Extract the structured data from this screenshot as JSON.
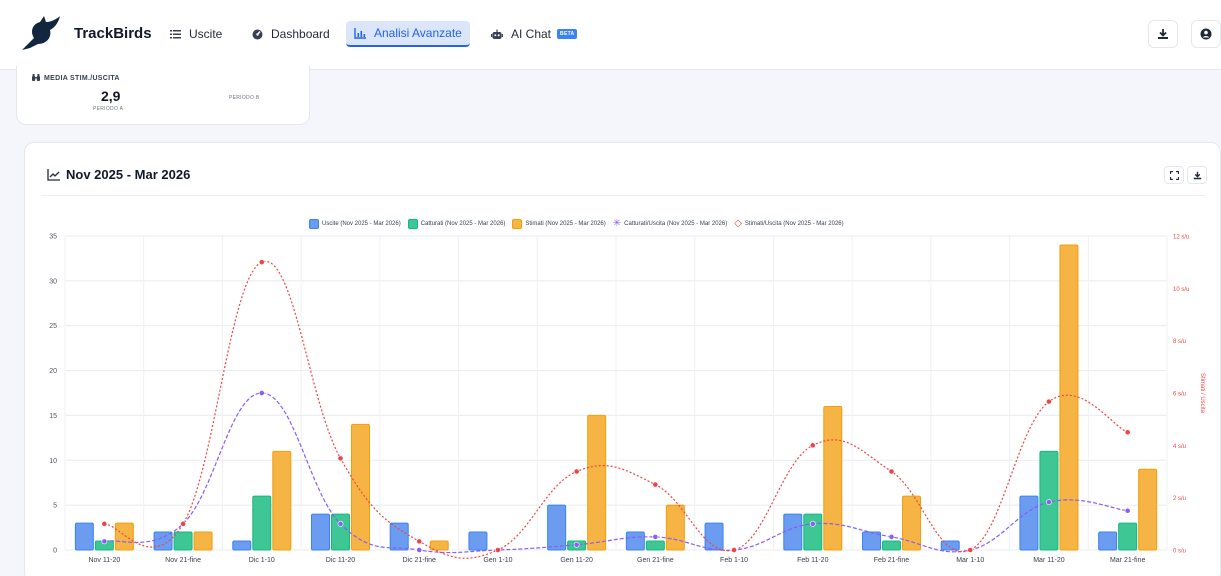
{
  "nav": {
    "brand": "TrackBirds",
    "items": [
      {
        "label": "Uscite",
        "icon": "list-icon"
      },
      {
        "label": "Dashboard",
        "icon": "dashboard-icon"
      },
      {
        "label": "Analisi Avanzate",
        "icon": "chart-icon",
        "active": true
      },
      {
        "label": "AI Chat",
        "icon": "robot-icon",
        "badge": "BETA"
      }
    ],
    "right_buttons": [
      "download-icon",
      "user-icon"
    ]
  },
  "stat": {
    "title": "MEDIA STIM./USCITA",
    "value": "2,9",
    "period_a": "PERIODO A",
    "period_b": "PERIODO B"
  },
  "chart_card": {
    "title": "Nov 2025 - Mar 2026",
    "buttons": [
      "fullscreen-icon",
      "download-icon"
    ]
  },
  "colors": {
    "uscite": "#6b9cf0",
    "catturati": "#3ec795",
    "stimati": "#f5b444",
    "catt_line": "#8b5cf6",
    "stim_line": "#ef4444",
    "accent": "#2563eb"
  },
  "chart_data": {
    "type": "bar",
    "categories": [
      "Nov 11-20",
      "Nov 21-fine",
      "Dic 1-10",
      "Dic 11-20",
      "Dic 21-fine",
      "Gen 1-10",
      "Gen 11-20",
      "Gen 21-fine",
      "Feb 1-10",
      "Feb 11-20",
      "Feb 21-fine",
      "Mar 1-10",
      "Mar 11-20",
      "Mar 21-fine"
    ],
    "series": [
      {
        "name": "Uscite (Nov 2025 - Mar 2026)",
        "kind": "bar",
        "axis": "left",
        "values": [
          3,
          2,
          1,
          4,
          3,
          2,
          5,
          2,
          3,
          4,
          2,
          1,
          6,
          2
        ]
      },
      {
        "name": "Catturati (Nov 2025 - Mar 2026)",
        "kind": "bar",
        "axis": "left",
        "values": [
          1,
          2,
          6,
          4,
          0,
          0,
          1,
          1,
          0,
          4,
          1,
          0,
          11,
          3
        ]
      },
      {
        "name": "Stimati (Nov 2025 - Mar 2026)",
        "kind": "bar",
        "axis": "left",
        "values": [
          3,
          2,
          11,
          14,
          1,
          0,
          15,
          5,
          0,
          16,
          6,
          0,
          34,
          9
        ]
      },
      {
        "name": "Catturati/Uscita (Nov 2025 - Mar 2026)",
        "kind": "line",
        "axis": "right",
        "values": [
          0.33,
          1.0,
          6.0,
          1.0,
          0,
          0,
          0.2,
          0.5,
          0,
          1.0,
          0.5,
          0,
          1.83,
          1.5
        ]
      },
      {
        "name": "Stimati/Uscita (Nov 2025 - Mar 2026)",
        "kind": "line",
        "axis": "right",
        "values": [
          1.0,
          1.0,
          11.0,
          3.5,
          0.33,
          0,
          3.0,
          2.5,
          0,
          4.0,
          3.0,
          0,
          5.67,
          4.5
        ]
      }
    ],
    "y_left": {
      "min": 0,
      "max": 35,
      "ticks": [
        0,
        5,
        10,
        15,
        20,
        25,
        30,
        35
      ]
    },
    "y_right": {
      "min": 0,
      "max": 12,
      "ticks": [
        "0 s/u",
        "2 s/u",
        "4 s/u",
        "6 s/u",
        "8 s/u",
        "10 s/u",
        "12 s/u"
      ],
      "label": "Stimati / Uscita"
    },
    "legend_position": "top-center",
    "grid": true
  }
}
